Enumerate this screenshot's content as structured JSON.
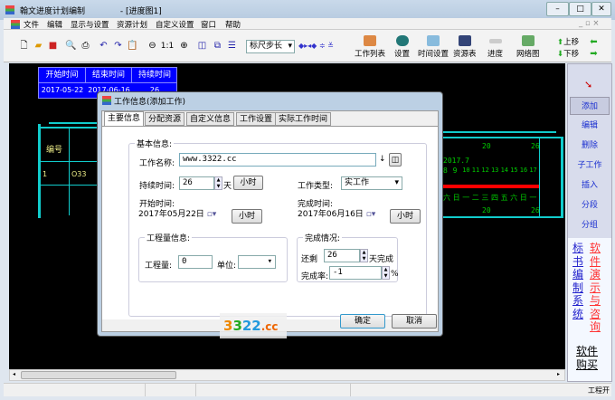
{
  "window": {
    "title": "翰文进度计划编制",
    "doc": "- [进度图1]"
  },
  "menu": [
    "文件",
    "编辑",
    "显示与设置",
    "资源计划",
    "自定义设置",
    "窗口",
    "帮助"
  ],
  "toolbar": {
    "zoom_label": "1:1",
    "ruler_select": "标尺步长",
    "big": [
      "工作列表",
      "设置",
      "时间设置",
      "资源表",
      "进度",
      "网络图"
    ],
    "up": "上移",
    "down": "下移"
  },
  "table": {
    "headers": [
      "开始时间",
      "结束时间",
      "持续时间"
    ],
    "row": [
      "2017-05-22",
      "2017-06-16",
      "26"
    ]
  },
  "gantt": {
    "col_header": "编号",
    "row_num": "1",
    "row_name": "O33",
    "scale_top": [
      "20",
      "26"
    ],
    "month": "2017.7",
    "days": [
      "8",
      "9",
      "10",
      "11",
      "12",
      "13",
      "14",
      "15",
      "16",
      "17"
    ],
    "weekdays": [
      "六",
      "日",
      "一",
      "二",
      "三",
      "四",
      "五",
      "六",
      "日",
      "一"
    ]
  },
  "dialog": {
    "title": "工作信息(添加工作)",
    "tabs": [
      "主要信息",
      "分配资源",
      "自定义信息",
      "工作设置",
      "实际工作时间"
    ],
    "basic": "基本信息:",
    "name_label": "工作名称:",
    "name_value": "www.3322.cc",
    "dur_label": "持续时间:",
    "dur_value": "26",
    "day_unit": "天",
    "hour_btn": "小时",
    "type_label": "工作类型:",
    "type_value": "实工作",
    "start_label": "开始时间:",
    "start_value": "2017年05月22日",
    "end_label": "完成时间:",
    "end_value": "2017年06月16日",
    "qty_group": "工程量信息:",
    "qty_label": "工程量:",
    "qty_value": "0",
    "unit_label": "单位:",
    "done_group": "完成情况:",
    "remain_label": "还剩",
    "remain_value": "26",
    "remain_suffix": "天完成",
    "rate_label": "完成率:",
    "rate_value": "-1",
    "percent": "%",
    "ok": "确定",
    "cancel": "取消"
  },
  "watermark": "3322.cc",
  "right_panel": {
    "buttons": [
      "添加",
      "编辑",
      "删除",
      "子工作",
      "插入",
      "分段",
      "分组"
    ],
    "link1": "标书编制系统",
    "link2": "软件演示与咨询",
    "buy": "软件购买"
  },
  "status": {
    "right": "工程开"
  }
}
